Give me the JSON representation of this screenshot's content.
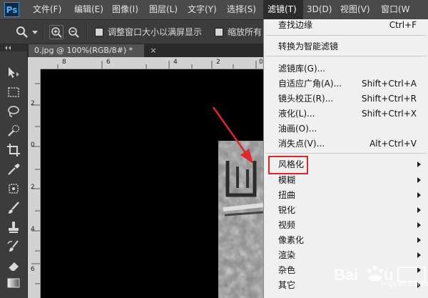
{
  "app": {
    "logo": "Ps"
  },
  "menubar": {
    "items": [
      {
        "label": "文件(F)"
      },
      {
        "label": "编辑(E)"
      },
      {
        "label": "图像(I)"
      },
      {
        "label": "图层(L)"
      },
      {
        "label": "文字(Y)"
      },
      {
        "label": "选择(S)"
      },
      {
        "label": "滤镜(T)"
      },
      {
        "label": "3D(D)"
      },
      {
        "label": "视图(V)"
      },
      {
        "label": "窗口(W"
      }
    ],
    "active": "滤镜(T)"
  },
  "options_bar": {
    "resize_windows_label": "调整窗口大小以满屏显示",
    "zoom_all_label": "缩放所有"
  },
  "document": {
    "tab_title": "0.jpg @ 100%(RGB/8#) *",
    "close_glyph": "×",
    "ruler_top_labels": [
      "8",
      "6",
      "4",
      "2",
      "0"
    ],
    "ruler_left_labels": [
      "2",
      "0",
      "2",
      "4",
      "6"
    ]
  },
  "filter_menu": {
    "items": [
      {
        "label": "查找边缘",
        "shortcut": "Ctrl+F"
      },
      {
        "label": "转换为智能滤镜",
        "shortcut": ""
      },
      {
        "label": "滤镜库(G)...",
        "shortcut": ""
      },
      {
        "label": "自适应广角(A)...",
        "shortcut": "Shift+Ctrl+A"
      },
      {
        "label": "镜头校正(R)...",
        "shortcut": "Shift+Ctrl+R"
      },
      {
        "label": "液化(L)...",
        "shortcut": "Shift+Ctrl+X"
      },
      {
        "label": "油画(O)...",
        "shortcut": ""
      },
      {
        "label": "消失点(V)...",
        "shortcut": "Alt+Ctrl+V"
      },
      {
        "label": "风格化",
        "shortcut": ""
      },
      {
        "label": "模糊",
        "shortcut": ""
      },
      {
        "label": "扭曲",
        "shortcut": ""
      },
      {
        "label": "锐化",
        "shortcut": ""
      },
      {
        "label": "视频",
        "shortcut": ""
      },
      {
        "label": "像素化",
        "shortcut": ""
      },
      {
        "label": "渲染",
        "shortcut": ""
      },
      {
        "label": "杂色",
        "shortcut": ""
      },
      {
        "label": "其它",
        "shortcut": ""
      }
    ],
    "highlighted": "风格化"
  },
  "watermark": {
    "text": "jingyan.baidu.com"
  },
  "colors": {
    "accent_red": "#e0262b",
    "menu_bg": "#f0f0f0",
    "ui_dark": "#3c3c3c"
  }
}
